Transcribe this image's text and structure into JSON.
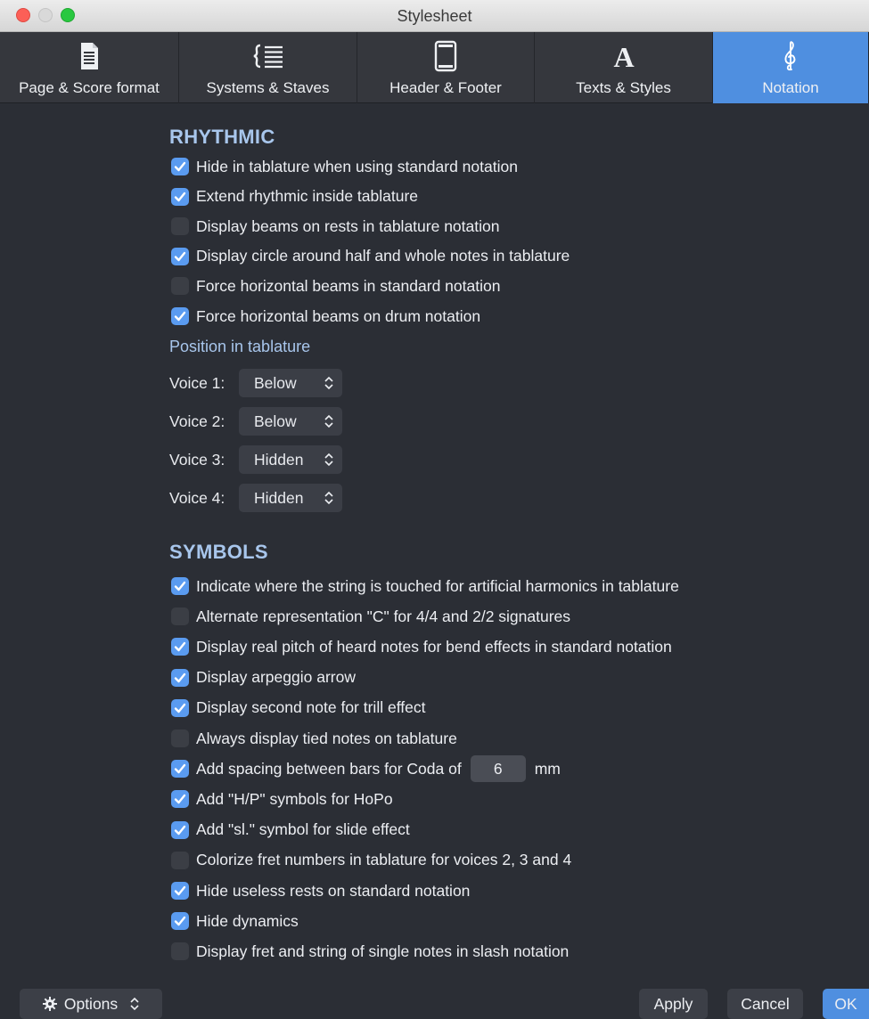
{
  "window": {
    "title": "Stylesheet"
  },
  "tabs": [
    {
      "label": "Page & Score format",
      "icon": "page-icon"
    },
    {
      "label": "Systems & Staves",
      "icon": "staves-icon"
    },
    {
      "label": "Header & Footer",
      "icon": "header-footer-icon"
    },
    {
      "label": "Texts & Styles",
      "icon": "texts-icon"
    },
    {
      "label": "Notation",
      "icon": "treble-clef-icon",
      "active": true
    }
  ],
  "rhythmic": {
    "heading": "RHYTHMIC",
    "options": [
      {
        "label": "Hide in tablature when using standard notation",
        "checked": true
      },
      {
        "label": "Extend rhythmic inside tablature",
        "checked": true
      },
      {
        "label": "Display beams on rests in tablature notation",
        "checked": false
      },
      {
        "label": "Display circle around half and whole notes in tablature",
        "checked": true
      },
      {
        "label": "Force horizontal beams in standard notation",
        "checked": false
      },
      {
        "label": "Force horizontal beams on drum notation",
        "checked": true
      }
    ],
    "position_heading": "Position in tablature",
    "voices": [
      {
        "label": "Voice 1:",
        "value": "Below"
      },
      {
        "label": "Voice 2:",
        "value": "Below"
      },
      {
        "label": "Voice 3:",
        "value": "Hidden"
      },
      {
        "label": "Voice 4:",
        "value": "Hidden"
      }
    ]
  },
  "symbols": {
    "heading": "SYMBOLS",
    "options": [
      {
        "label": "Indicate where the string is touched for artificial harmonics in tablature",
        "checked": true
      },
      {
        "label": "Alternate representation \"C\" for 4/4 and 2/2 signatures",
        "checked": false
      },
      {
        "label": "Display real pitch of heard notes for bend effects in standard notation",
        "checked": true
      },
      {
        "label": "Display arpeggio arrow",
        "checked": true
      },
      {
        "label": "Display second note for trill effect",
        "checked": true
      },
      {
        "label": "Always display tied notes on tablature",
        "checked": false
      },
      {
        "label": "Add spacing between bars for Coda of",
        "checked": true,
        "value": "6",
        "unit": "mm"
      },
      {
        "label": "Add \"H/P\" symbols for HoPo",
        "checked": true
      },
      {
        "label": "Add \"sl.\" symbol for slide effect",
        "checked": true
      },
      {
        "label": "Colorize fret numbers in tablature for voices 2, 3 and 4",
        "checked": false
      },
      {
        "label": "Hide useless rests on standard notation",
        "checked": true
      },
      {
        "label": "Hide dynamics",
        "checked": true
      },
      {
        "label": "Display fret and string of single notes in slash notation",
        "checked": false
      }
    ]
  },
  "footer": {
    "options_label": "Options",
    "apply_label": "Apply",
    "cancel_label": "Cancel",
    "ok_label": "OK"
  },
  "colors": {
    "accent": "#4f8fe0",
    "checkbox_on": "#5a9bf0",
    "heading": "#a8c6ec",
    "background": "#2b2e35"
  }
}
